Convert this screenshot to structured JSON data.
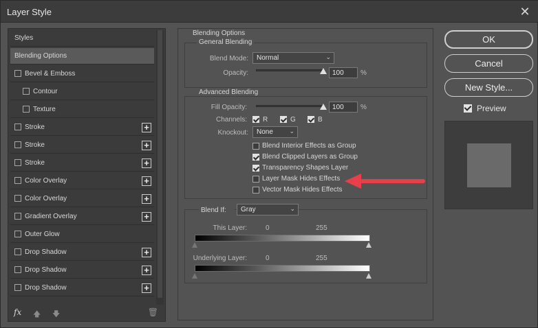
{
  "window": {
    "title": "Layer Style",
    "close_glyph": "✕"
  },
  "left_panel": {
    "items": [
      {
        "label": "Styles",
        "checkbox": false,
        "plus": false,
        "indent": 0,
        "selected": false
      },
      {
        "label": "Blending Options",
        "checkbox": false,
        "plus": false,
        "indent": 0,
        "selected": true
      },
      {
        "label": "Bevel & Emboss",
        "checkbox": true,
        "plus": false,
        "indent": 0,
        "selected": false
      },
      {
        "label": "Contour",
        "checkbox": true,
        "plus": false,
        "indent": 1,
        "selected": false
      },
      {
        "label": "Texture",
        "checkbox": true,
        "plus": false,
        "indent": 1,
        "selected": false
      },
      {
        "label": "Stroke",
        "checkbox": true,
        "plus": true,
        "indent": 0,
        "selected": false
      },
      {
        "label": "Stroke",
        "checkbox": true,
        "plus": true,
        "indent": 0,
        "selected": false
      },
      {
        "label": "Stroke",
        "checkbox": true,
        "plus": true,
        "indent": 0,
        "selected": false
      },
      {
        "label": "Color Overlay",
        "checkbox": true,
        "plus": true,
        "indent": 0,
        "selected": false
      },
      {
        "label": "Color Overlay",
        "checkbox": true,
        "plus": true,
        "indent": 0,
        "selected": false
      },
      {
        "label": "Gradient Overlay",
        "checkbox": true,
        "plus": true,
        "indent": 0,
        "selected": false
      },
      {
        "label": "Outer Glow",
        "checkbox": true,
        "plus": false,
        "indent": 0,
        "selected": false
      },
      {
        "label": "Drop Shadow",
        "checkbox": true,
        "plus": true,
        "indent": 0,
        "selected": false
      },
      {
        "label": "Drop Shadow",
        "checkbox": true,
        "plus": true,
        "indent": 0,
        "selected": false
      },
      {
        "label": "Drop Shadow",
        "checkbox": true,
        "plus": true,
        "indent": 0,
        "selected": false
      }
    ],
    "tools": {
      "fx_label": "fx",
      "up_glyph": "🡅",
      "down_glyph": "🡇",
      "trash_glyph": "🗑"
    }
  },
  "blending": {
    "section_title": "Blending Options",
    "general": {
      "title": "General Blending",
      "blend_mode_label": "Blend Mode:",
      "blend_mode_value": "Normal",
      "opacity_label": "Opacity:",
      "opacity_value": "100",
      "opacity_unit": "%",
      "opacity_level": 1.0
    },
    "advanced": {
      "title": "Advanced Blending",
      "fill_opacity_label": "Fill Opacity:",
      "fill_opacity_value": "100",
      "fill_opacity_unit": "%",
      "fill_opacity_level": 1.0,
      "channels_label": "Channels:",
      "channels": [
        {
          "label": "R",
          "checked": true
        },
        {
          "label": "G",
          "checked": true
        },
        {
          "label": "B",
          "checked": true
        }
      ],
      "knockout_label": "Knockout:",
      "knockout_value": "None",
      "options": [
        {
          "label": "Blend Interior Effects as Group",
          "checked": false
        },
        {
          "label": "Blend Clipped Layers as Group",
          "checked": true
        },
        {
          "label": "Transparency Shapes Layer",
          "checked": true
        },
        {
          "label": "Layer Mask Hides Effects",
          "checked": false
        },
        {
          "label": "Vector Mask Hides Effects",
          "checked": false
        }
      ]
    },
    "blend_if": {
      "label": "Blend If:",
      "value": "Gray",
      "this_layer_label": "This Layer:",
      "this_layer_min": "0",
      "this_layer_max": "255",
      "underlying_label": "Underlying Layer:",
      "underlying_min": "0",
      "underlying_max": "255"
    }
  },
  "buttons": {
    "ok": "OK",
    "cancel": "Cancel",
    "new_style": "New Style..."
  },
  "preview": {
    "label": "Preview",
    "checked": true
  },
  "annotation": {
    "color": "#e8404a"
  }
}
